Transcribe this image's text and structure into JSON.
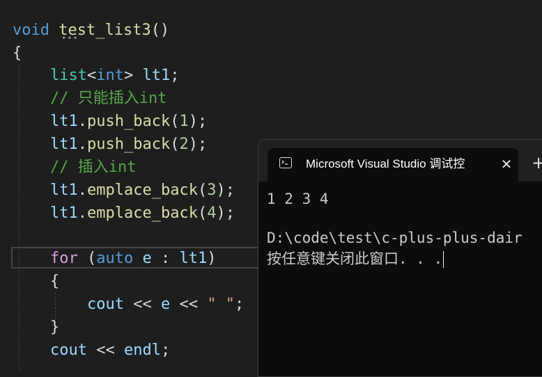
{
  "editor": {
    "lines": [
      {
        "parts": [
          "void",
          " ",
          "test_list3",
          "()"
        ]
      },
      {
        "parts": [
          "{"
        ]
      },
      {
        "parts": [
          "list",
          "<",
          "int",
          ">",
          " ",
          "lt1",
          ";"
        ]
      },
      {
        "parts": [
          "// 只能插入int"
        ]
      },
      {
        "parts": [
          "lt1",
          ".",
          "push_back",
          "(",
          "1",
          ");"
        ]
      },
      {
        "parts": [
          "lt1",
          ".",
          "push_back",
          "(",
          "2",
          ");"
        ]
      },
      {
        "parts": [
          "// 插入int"
        ]
      },
      {
        "parts": [
          "lt1",
          ".",
          "emplace_back",
          "(",
          "3",
          ");"
        ]
      },
      {
        "parts": [
          "lt1",
          ".",
          "emplace_back",
          "(",
          "4",
          ");"
        ]
      },
      {
        "parts": []
      },
      {
        "parts": [
          "for",
          " (",
          "auto",
          " ",
          "e",
          " : ",
          "lt1",
          ")"
        ]
      },
      {
        "parts": [
          "{"
        ]
      },
      {
        "parts": [
          "cout",
          " << ",
          "e",
          " << ",
          "\" \"",
          ";"
        ]
      },
      {
        "parts": [
          "}"
        ]
      },
      {
        "parts": [
          "cout",
          " << ",
          "endl",
          ";"
        ]
      }
    ],
    "squiggle": "•••"
  },
  "console": {
    "tab_title": "Microsoft Visual Studio 调试控",
    "close_glyph": "✕",
    "new_tab_glyph": "+",
    "output": [
      "1 2 3 4",
      "",
      "D:\\code\\test\\c-plus-plus-dair",
      "按任意键关闭此窗口. . ."
    ]
  }
}
